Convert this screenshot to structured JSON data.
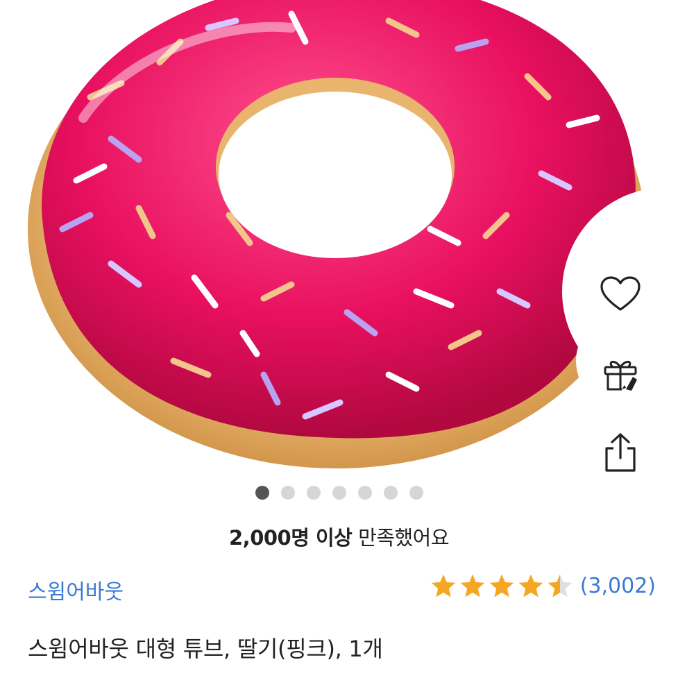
{
  "product_image": {
    "icon": "donut-float-image",
    "dots_total": 7,
    "active_dot": 0
  },
  "actions": {
    "wishlist_icon": "heart-icon",
    "gift_icon": "gift-icon",
    "share_icon": "share-icon"
  },
  "satisfaction": {
    "strong": "2,000명 이상",
    "rest": " 만족했어요"
  },
  "brand": {
    "name": "스윔어바웃"
  },
  "rating": {
    "value": 4.5,
    "max": 5,
    "count": "(3,002)",
    "star_color": "#f5a623"
  },
  "product": {
    "title": "스윔어바웃 대형 튜브, 딸기(핑크), 1개"
  },
  "colors": {
    "accent_blue": "#3a78d6",
    "frosting": "#e8105f",
    "dough": "#e9b56e"
  }
}
